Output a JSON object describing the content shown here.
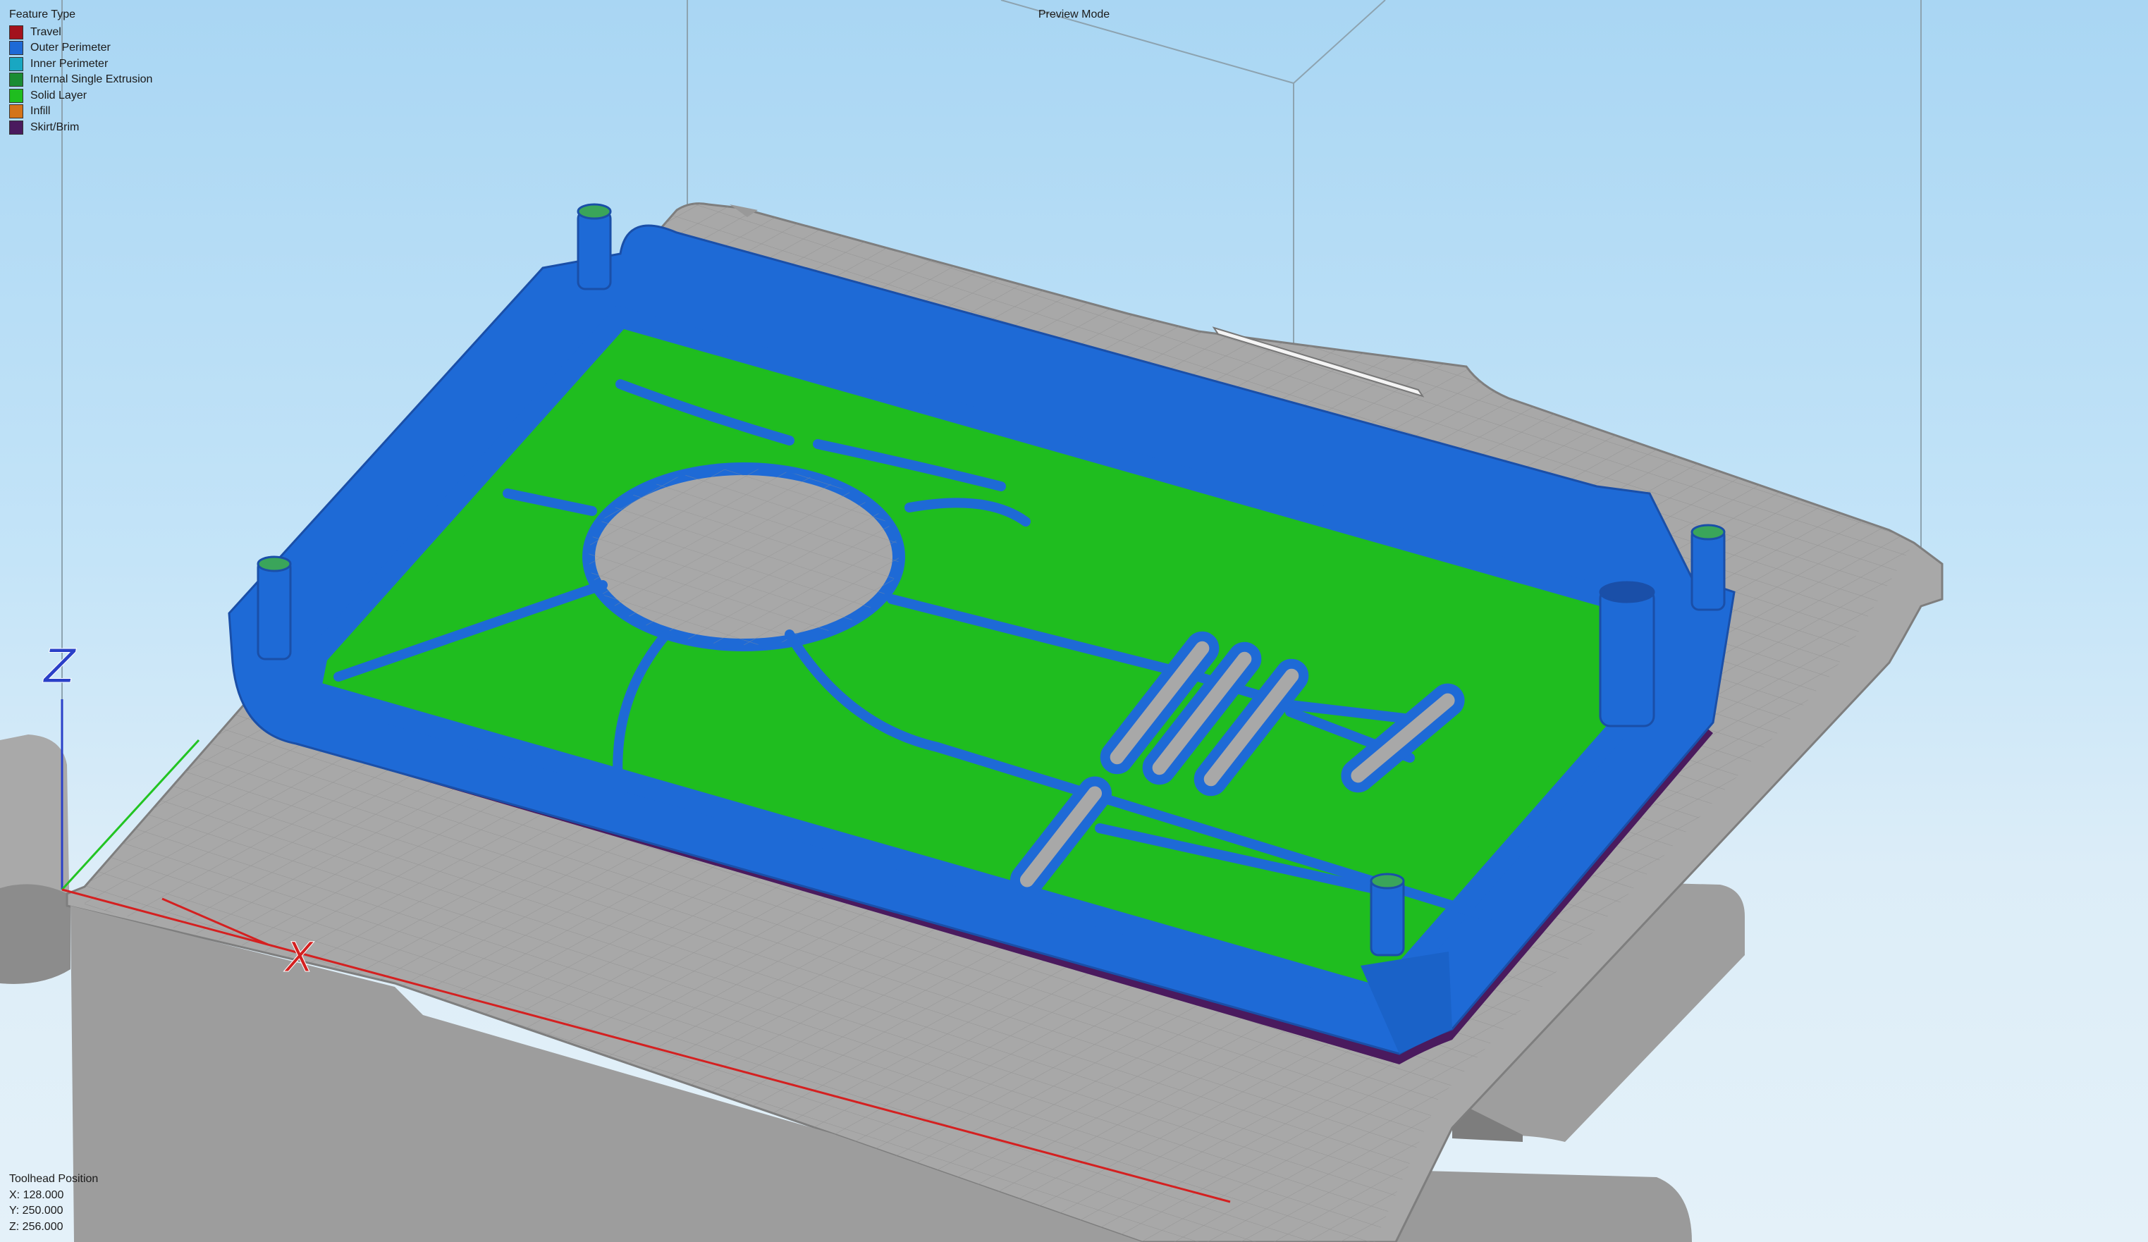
{
  "view_mode": "Preview Mode",
  "legend": {
    "title": "Feature Type",
    "items": [
      {
        "label": "Travel",
        "color": "#a3121c"
      },
      {
        "label": "Outer Perimeter",
        "color": "#1e6ad6"
      },
      {
        "label": "Inner Perimeter",
        "color": "#19a7c2"
      },
      {
        "label": "Internal Single Extrusion",
        "color": "#1a8c34"
      },
      {
        "label": "Solid Layer",
        "color": "#1fbd1f"
      },
      {
        "label": "Infill",
        "color": "#d4741a"
      },
      {
        "label": "Skirt/Brim",
        "color": "#4a1a5e"
      }
    ]
  },
  "toolhead": {
    "title": "Toolhead Position",
    "x": "X: 128.000",
    "y": "Y: 250.000",
    "z": "Z: 256.000"
  },
  "axes": {
    "x": "X",
    "z": "Z"
  },
  "colors": {
    "outer_perimeter": "#1e6ad6",
    "solid_layer": "#1fbd1f",
    "build_plate": "#a8a8a8",
    "x_axis": "#d42020",
    "y_axis": "#22c422",
    "z_axis": "#2a40c8"
  }
}
